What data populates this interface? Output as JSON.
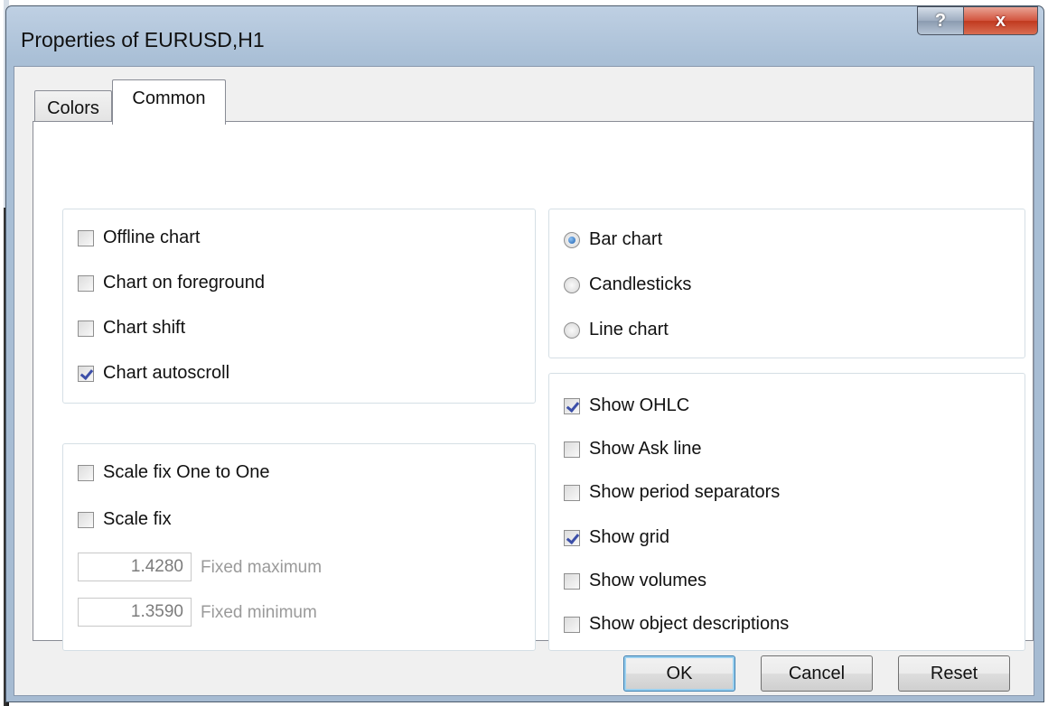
{
  "window": {
    "title": "Properties of EURUSD,H1",
    "help_label": "?",
    "close_label": "x"
  },
  "tabs": [
    {
      "label": "Colors",
      "active": false
    },
    {
      "label": "Common",
      "active": true
    }
  ],
  "general_options": [
    {
      "label": "Offline chart",
      "checked": false
    },
    {
      "label": "Chart on foreground",
      "checked": false
    },
    {
      "label": "Chart shift",
      "checked": false
    },
    {
      "label": "Chart autoscroll",
      "checked": true
    }
  ],
  "chart_type": [
    {
      "label": "Bar chart",
      "selected": true
    },
    {
      "label": "Candlesticks",
      "selected": false
    },
    {
      "label": "Line chart",
      "selected": false
    }
  ],
  "scale": {
    "fix_one_to_one": {
      "label": "Scale fix One to One",
      "checked": false
    },
    "fix": {
      "label": "Scale fix",
      "checked": false
    },
    "fixed_maximum": {
      "value": "1.4280",
      "label": "Fixed maximum"
    },
    "fixed_minimum": {
      "value": "1.3590",
      "label": "Fixed minimum"
    }
  },
  "display_options": [
    {
      "label": "Show OHLC",
      "checked": true
    },
    {
      "label": "Show Ask line",
      "checked": false
    },
    {
      "label": "Show period separators",
      "checked": false
    },
    {
      "label": "Show grid",
      "checked": true
    },
    {
      "label": "Show volumes",
      "checked": false
    },
    {
      "label": "Show object descriptions",
      "checked": false
    }
  ],
  "buttons": {
    "ok": "OK",
    "cancel": "Cancel",
    "reset": "Reset"
  }
}
